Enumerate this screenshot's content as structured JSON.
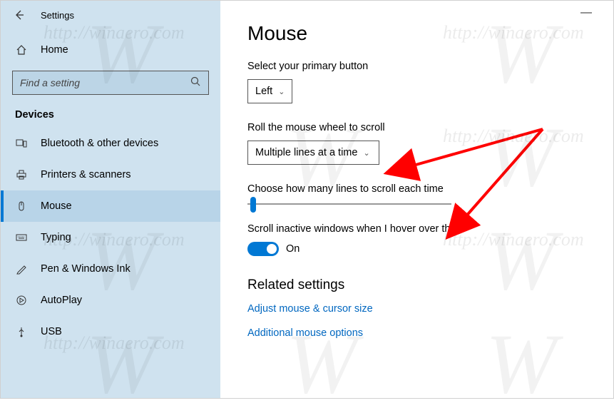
{
  "window": {
    "title": "Settings"
  },
  "sidebar": {
    "home_label": "Home",
    "search_placeholder": "Find a setting",
    "category_label": "Devices",
    "items": [
      {
        "label": "Bluetooth & other devices"
      },
      {
        "label": "Printers & scanners"
      },
      {
        "label": "Mouse"
      },
      {
        "label": "Typing"
      },
      {
        "label": "Pen & Windows Ink"
      },
      {
        "label": "AutoPlay"
      },
      {
        "label": "USB"
      }
    ]
  },
  "main": {
    "page_title": "Mouse",
    "primary_button_label": "Select your primary button",
    "primary_button_value": "Left",
    "scroll_mode_label": "Roll the mouse wheel to scroll",
    "scroll_mode_value": "Multiple lines at a time",
    "scroll_lines_label": "Choose how many lines to scroll each time",
    "scroll_inactive_label": "Scroll inactive windows when I hover over them",
    "scroll_inactive_state": "On",
    "related_heading": "Related settings",
    "link1": "Adjust mouse & cursor size",
    "link2": "Additional mouse options"
  }
}
